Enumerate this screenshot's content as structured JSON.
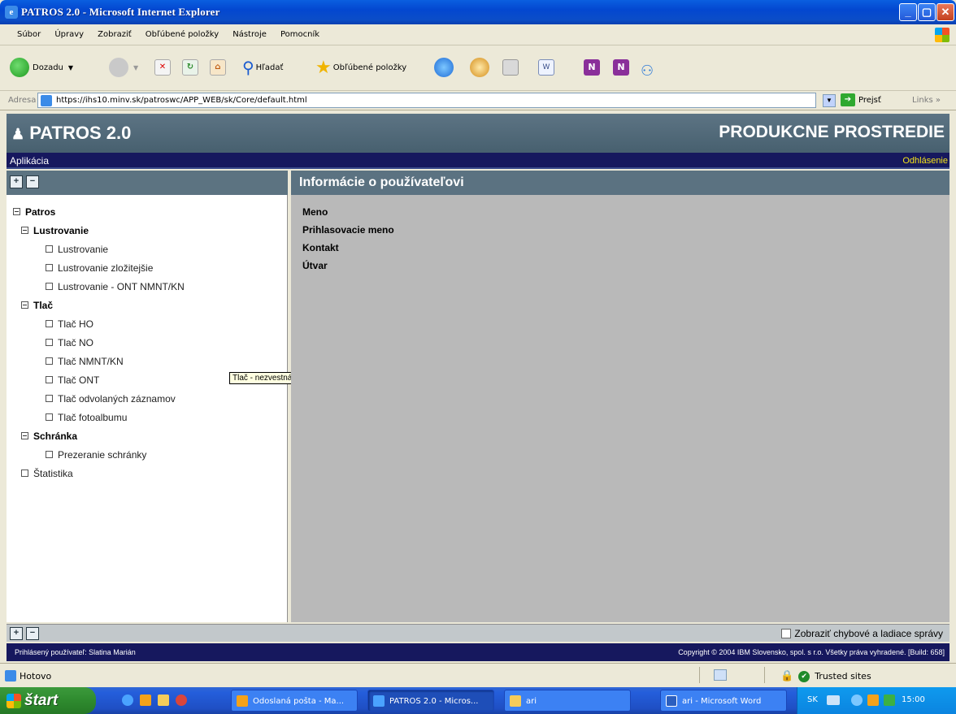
{
  "window": {
    "title": "PATROS 2.0 - Microsoft Internet Explorer"
  },
  "menu": [
    "Súbor",
    "Úpravy",
    "Zobraziť",
    "Obľúbené položky",
    "Nástroje",
    "Pomocník"
  ],
  "toolbar": {
    "back_label": "Dozadu",
    "search_label": "Hľadať",
    "favorites_label": "Obľúbené položky"
  },
  "address": {
    "label": "Adresa",
    "url": "https://ihs10.minv.sk/patroswc/APP_WEB/sk/Core/default.html",
    "go_label": "Prejsť",
    "links_label": "Links"
  },
  "app": {
    "logo": "PATROS 2.0",
    "environment": "PRODUKCNE PROSTREDIE",
    "nav_left": "Aplikácia",
    "nav_right": "Odhlásenie",
    "tree": [
      {
        "label": "Patros",
        "level": 0,
        "expanded": true
      },
      {
        "label": "Lustrovanie",
        "level": 1,
        "expanded": true
      },
      {
        "label": "Lustrovanie",
        "level": 2
      },
      {
        "label": "Lustrovanie zložitejšie",
        "level": 2
      },
      {
        "label": "Lustrovanie - ONT NMNT/KN",
        "level": 2
      },
      {
        "label": "Tlač",
        "level": 1,
        "expanded": true
      },
      {
        "label": "Tlač HO",
        "level": 2
      },
      {
        "label": "Tlač NO",
        "level": 2
      },
      {
        "label": "Tlač NMNT/KN",
        "level": 2
      },
      {
        "label": "Tlač ONT",
        "level": 2
      },
      {
        "label": "Tlač odvolaných záznamov",
        "level": 2
      },
      {
        "label": "Tlač fotoalbumu",
        "level": 2
      },
      {
        "label": "Schránka",
        "level": 1,
        "expanded": true
      },
      {
        "label": "Prezeranie schránky",
        "level": 2
      },
      {
        "label": "Štatistika",
        "level": 1,
        "expanded": false
      }
    ],
    "tooltip": "Tlač - nezvestná osoba",
    "info_title": "Informácie o používateľovi",
    "info_fields": [
      "Meno",
      "Prihlasovacie meno",
      "Kontakt",
      "Útvar"
    ],
    "debug_checkbox_label": "Zobraziť chybové a ladiace správy",
    "footer_left": "Prihlásený používateľ: Slatina Marián",
    "footer_right": "Copyright © 2004 IBM Slovensko, spol. s r.o. Všetky práva vyhradené. [Build: 658]"
  },
  "status": {
    "text": "Hotovo",
    "zone": "Trusted sites"
  },
  "taskbar": {
    "start": "štart",
    "tasks": [
      "Odoslaná pošta - Ma...",
      "PATROS 2.0 - Micros...",
      "ari",
      "ari - Microsoft Word"
    ],
    "lang": "SK",
    "clock": "15:00"
  },
  "colors": {
    "header": "#5d7484",
    "nav": "#16185e",
    "logout": "#f3e21a",
    "content": "#b9b9b9"
  }
}
